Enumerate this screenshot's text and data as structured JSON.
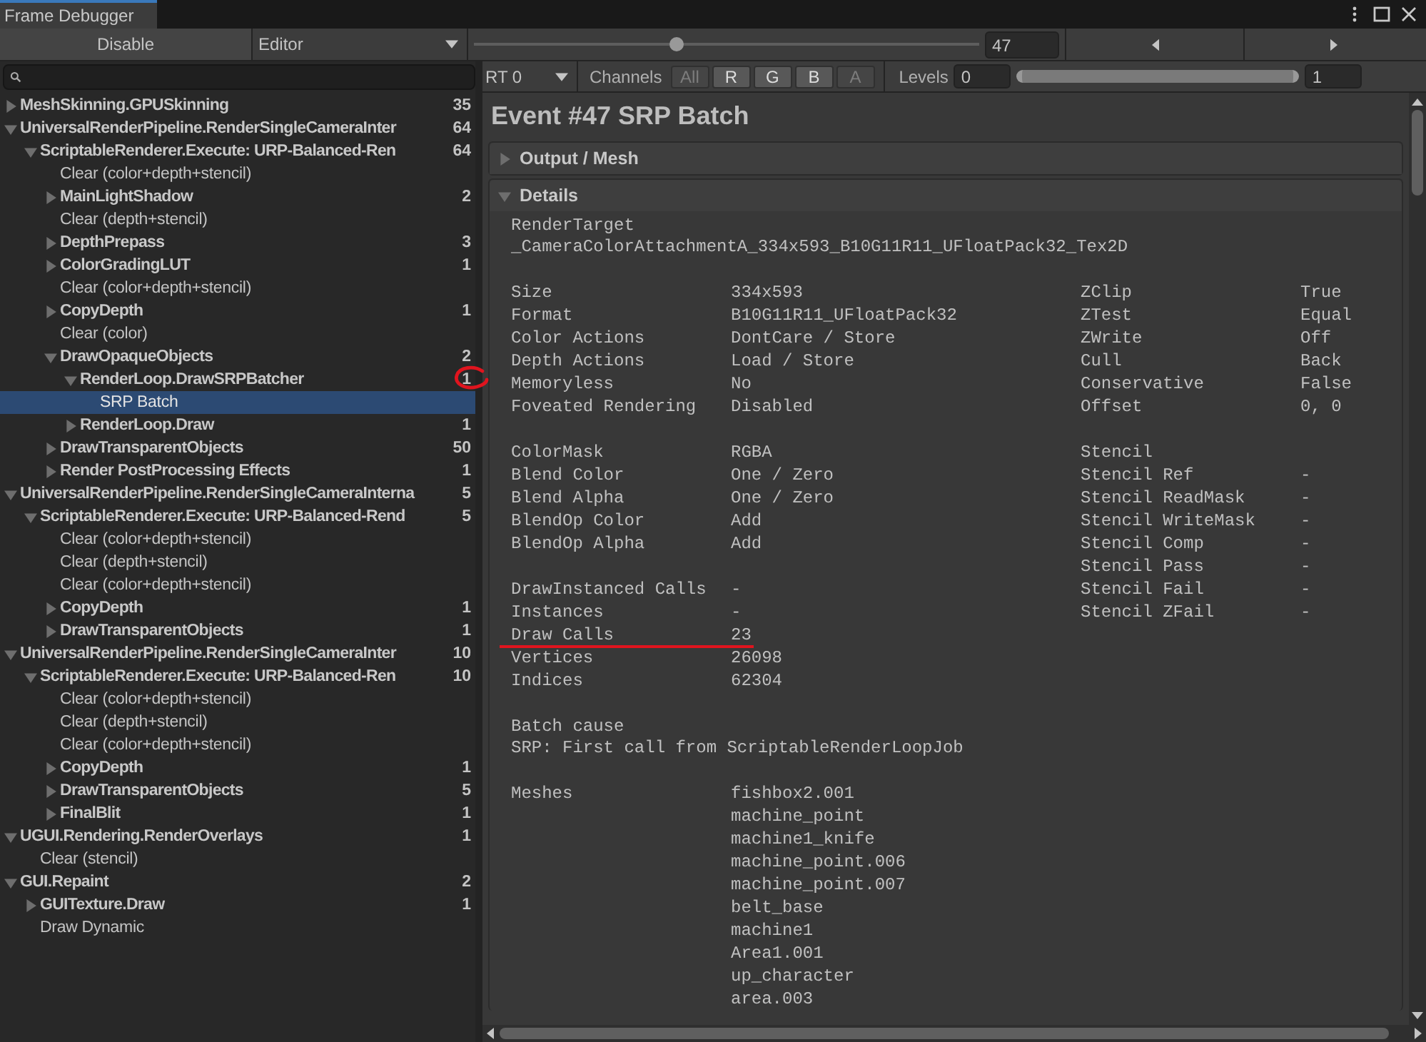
{
  "window": {
    "title": "Frame Debugger"
  },
  "toolbar": {
    "disable_button": "Disable",
    "target_dropdown": "Editor",
    "event_slider": {
      "level": 0.4
    },
    "event_number": "47"
  },
  "events": [
    {
      "name": "MeshSkinning.GPUSkinning",
      "count": "35",
      "expanded": false,
      "selected": false
    },
    {
      "name": "UniversalRenderPipeline.RenderSingleCameraInter",
      "count": "64",
      "expanded": true,
      "selected": false,
      "children": [
        {
          "name": "ScriptableRenderer.Execute: URP-Balanced-Ren",
          "count": "64",
          "expanded": true,
          "selected": false,
          "children": [
            {
              "name": "Clear (color+depth+stencil)",
              "selected": false
            },
            {
              "name": "MainLightShadow",
              "count": "2",
              "expanded": false,
              "selected": false
            },
            {
              "name": "Clear (depth+stencil)",
              "selected": false
            },
            {
              "name": "DepthPrepass",
              "count": "3",
              "expanded": false,
              "selected": false
            },
            {
              "name": "ColorGradingLUT",
              "count": "1",
              "expanded": false,
              "selected": false
            },
            {
              "name": "Clear (color+depth+stencil)",
              "selected": false
            },
            {
              "name": "CopyDepth",
              "count": "1",
              "expanded": false,
              "selected": false
            },
            {
              "name": "Clear (color)",
              "selected": false
            },
            {
              "name": "DrawOpaqueObjects",
              "count": "2",
              "expanded": true,
              "selected": false,
              "children": [
                {
                  "name": "RenderLoop.DrawSRPBatcher",
                  "count": "1",
                  "expanded": true,
                  "selected": false,
                  "children": [
                    {
                      "name": "SRP Batch",
                      "selected": true
                    }
                  ]
                },
                {
                  "name": "RenderLoop.Draw",
                  "count": "1",
                  "expanded": false,
                  "selected": false
                }
              ]
            },
            {
              "name": "DrawTransparentObjects",
              "count": "50",
              "expanded": false,
              "selected": false
            },
            {
              "name": "Render PostProcessing Effects",
              "count": "1",
              "expanded": false,
              "selected": false
            }
          ]
        }
      ]
    },
    {
      "name": "UniversalRenderPipeline.RenderSingleCameraInterna",
      "count": "5",
      "expanded": true,
      "selected": false,
      "children": [
        {
          "name": "ScriptableRenderer.Execute: URP-Balanced-Rend",
          "count": "5",
          "expanded": true,
          "selected": false,
          "children": [
            {
              "name": "Clear (color+depth+stencil)",
              "selected": false
            },
            {
              "name": "Clear (depth+stencil)",
              "selected": false
            },
            {
              "name": "Clear (color+depth+stencil)",
              "selected": false
            },
            {
              "name": "CopyDepth",
              "count": "1",
              "expanded": false,
              "selected": false
            },
            {
              "name": "DrawTransparentObjects",
              "count": "1",
              "expanded": false,
              "selected": false
            }
          ]
        }
      ]
    },
    {
      "name": "UniversalRenderPipeline.RenderSingleCameraInter",
      "count": "10",
      "expanded": true,
      "selected": false,
      "children": [
        {
          "name": "ScriptableRenderer.Execute: URP-Balanced-Ren",
          "count": "10",
          "expanded": true,
          "selected": false,
          "children": [
            {
              "name": "Clear (color+depth+stencil)",
              "selected": false
            },
            {
              "name": "Clear (depth+stencil)",
              "selected": false
            },
            {
              "name": "Clear (color+depth+stencil)",
              "selected": false
            },
            {
              "name": "CopyDepth",
              "count": "1",
              "expanded": false,
              "selected": false
            },
            {
              "name": "DrawTransparentObjects",
              "count": "5",
              "expanded": false,
              "selected": false
            },
            {
              "name": "FinalBlit",
              "count": "1",
              "expanded": false,
              "selected": false
            }
          ]
        }
      ]
    },
    {
      "name": "UGUI.Rendering.RenderOverlays",
      "count": "1",
      "expanded": true,
      "selected": false,
      "children": [
        {
          "name": "Clear (stencil)",
          "selected": false
        }
      ]
    },
    {
      "name": "GUI.Repaint",
      "count": "2",
      "expanded": true,
      "selected": false,
      "children": [
        {
          "name": "GUITexture.Draw",
          "count": "1",
          "expanded": false,
          "selected": false
        },
        {
          "name": "Draw Dynamic",
          "selected": false
        }
      ]
    }
  ],
  "view_toolbar": {
    "render_target": "RT 0",
    "channels_label": "Channels",
    "channels": [
      {
        "label": "All",
        "on": false
      },
      {
        "label": "R",
        "on": true
      },
      {
        "label": "G",
        "on": true
      },
      {
        "label": "B",
        "on": true
      },
      {
        "label": "A",
        "on": false
      }
    ],
    "levels_label": "Levels",
    "levels_min": "0",
    "levels_max": "1",
    "levels_range": {
      "level": 1
    }
  },
  "event_title": "Event #47 SRP Batch",
  "sections": [
    {
      "title": "Output / Mesh",
      "expanded": false
    },
    {
      "title": "Details",
      "expanded": true
    }
  ],
  "details": {
    "render_target": {
      "label": "RenderTarget",
      "value": "_CameraColorAttachmentA_334x593_B10G11R11_UFloatPack32_Tex2D"
    },
    "groups": [
      [
        {
          "left": {
            "label": "Size",
            "value": "334x593"
          },
          "right": {
            "label": "ZClip",
            "value": "True"
          }
        },
        {
          "left": {
            "label": "Format",
            "value": "B10G11R11_UFloatPack32"
          },
          "right": {
            "label": "ZTest",
            "value": "Equal"
          }
        },
        {
          "left": {
            "label": "Color Actions",
            "value": "DontCare / Store"
          },
          "right": {
            "label": "ZWrite",
            "value": "Off"
          }
        },
        {
          "left": {
            "label": "Depth Actions",
            "value": "Load / Store"
          },
          "right": {
            "label": "Cull",
            "value": "Back"
          }
        },
        {
          "left": {
            "label": "Memoryless",
            "value": "No"
          },
          "right": {
            "label": "Conservative",
            "value": "False"
          }
        },
        {
          "left": {
            "label": "Foveated Rendering",
            "value": "Disabled"
          },
          "right": {
            "label": "Offset",
            "value": "0, 0"
          }
        }
      ],
      [
        {
          "left": {
            "label": "ColorMask",
            "value": "RGBA"
          },
          "right": {
            "label": "Stencil"
          }
        },
        {
          "left": {
            "label": "Blend Color",
            "value": "One / Zero"
          },
          "right": {
            "label": "Stencil Ref",
            "value": "-"
          }
        },
        {
          "left": {
            "label": "Blend Alpha",
            "value": "One / Zero"
          },
          "right": {
            "label": "Stencil ReadMask",
            "value": "-"
          }
        },
        {
          "left": {
            "label": "BlendOp Color",
            "value": "Add"
          },
          "right": {
            "label": "Stencil WriteMask",
            "value": "-"
          }
        },
        {
          "left": {
            "label": "BlendOp Alpha",
            "value": "Add"
          },
          "right": {
            "label": "Stencil Comp",
            "value": "-"
          }
        },
        {
          "right": {
            "label": "Stencil Pass",
            "value": "-"
          }
        },
        {
          "left": {
            "label": "DrawInstanced Calls",
            "value": "-"
          },
          "right": {
            "label": "Stencil Fail",
            "value": "-"
          }
        },
        {
          "left": {
            "label": "Instances",
            "value": "-"
          },
          "right": {
            "label": "Stencil ZFail",
            "value": "-"
          }
        },
        {
          "left": {
            "label": "Draw Calls",
            "value": "23"
          }
        },
        {
          "left": {
            "label": "Vertices",
            "value": "26098"
          }
        },
        {
          "left": {
            "label": "Indices",
            "value": "62304"
          }
        }
      ]
    ],
    "batch_cause": {
      "label": "Batch cause",
      "value": "SRP: First call from ScriptableRenderLoopJob"
    },
    "meshes": {
      "label": "Meshes",
      "items": [
        "fishbox2.001",
        "machine_point",
        "machine1_knife",
        "machine_point.006",
        "machine_point.007",
        "belt_base",
        "machine1",
        "Area1.001",
        "up_character",
        "area.003"
      ]
    }
  }
}
